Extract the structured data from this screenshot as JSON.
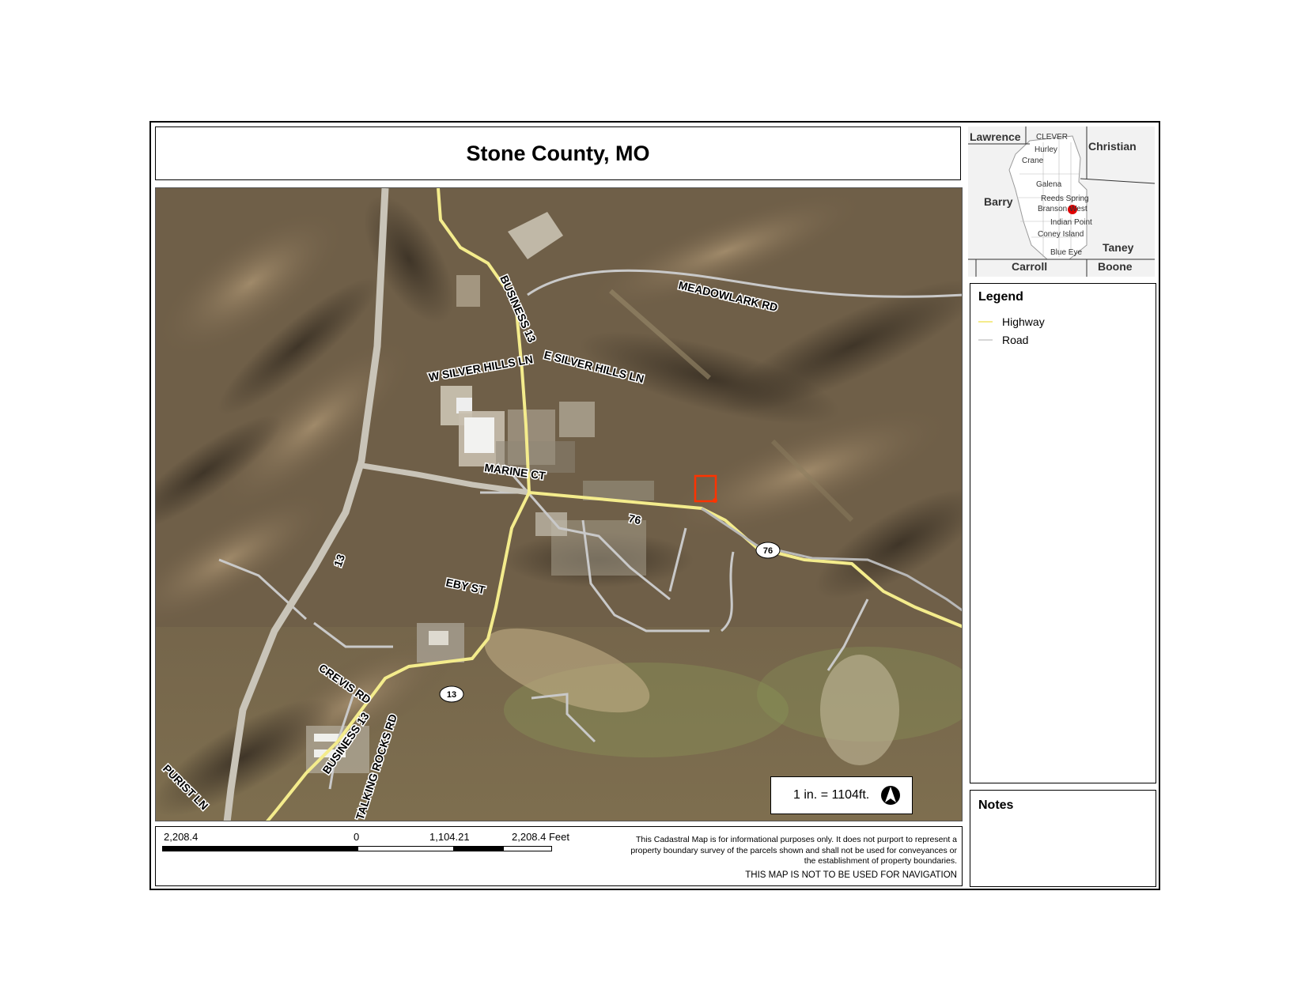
{
  "title": "Stone County, MO",
  "map": {
    "road_labels": {
      "business13_north": "BUSINESS 13",
      "meadowlark": "MEADOWLARK RD",
      "w_silver_hills": "W SILVER HILLS LN",
      "e_silver_hills": "E SILVER HILLS LN",
      "marine_ct": "MARINE CT",
      "route76_label": "76",
      "route13_label": "13",
      "eby_st": "EBY ST",
      "crevis_rd": "CREVIS RD",
      "business13_south": "BUSINESS 13",
      "talking_rocks": "TALKING ROCKS RD",
      "purist_ln": "PURIST LN"
    },
    "shields": {
      "us76": "76",
      "mo13": "13"
    },
    "colors": {
      "highway": "#f4ec8c",
      "road": "#c9c9c9",
      "parcel": "#ff3300"
    }
  },
  "scale_box": {
    "text": "1 in. = 1104ft.",
    "north_arrow": "north-arrow-icon"
  },
  "scale_bar": {
    "left_label": "2,208.4",
    "zero_label": "0",
    "mid_label": "1,104.21",
    "right_label": "2,208.4 Feet"
  },
  "disclaimer": {
    "text": "This Cadastral Map is for informational purposes only.  It does not purport to represent a property boundary survey of the parcels shown and shall not be used for conveyances or the establishment of property boundaries.",
    "nav_warning": "THIS MAP IS NOT TO BE USED FOR NAVIGATION"
  },
  "locator_map": {
    "counties": {
      "lawrence": "Lawrence",
      "christian": "Christian",
      "barry": "Barry",
      "taney": "Taney",
      "carroll": "Carroll",
      "boone": "Boone"
    },
    "towns": {
      "clever": "CLEVER",
      "hurley": "Hurley",
      "crane": "Crane",
      "galena": "Galena",
      "reeds_spring": "Reeds Spring",
      "branson_west": "Branson West",
      "indian_point": "Indian Point",
      "coney_island": "Coney Island",
      "blue_eye": "Blue Eye"
    }
  },
  "legend": {
    "title": "Legend",
    "items": [
      {
        "label": "Highway",
        "color": "#f4ec8c"
      },
      {
        "label": "Road",
        "color": "#d6d6d6"
      }
    ]
  },
  "notes": {
    "title": "Notes"
  }
}
